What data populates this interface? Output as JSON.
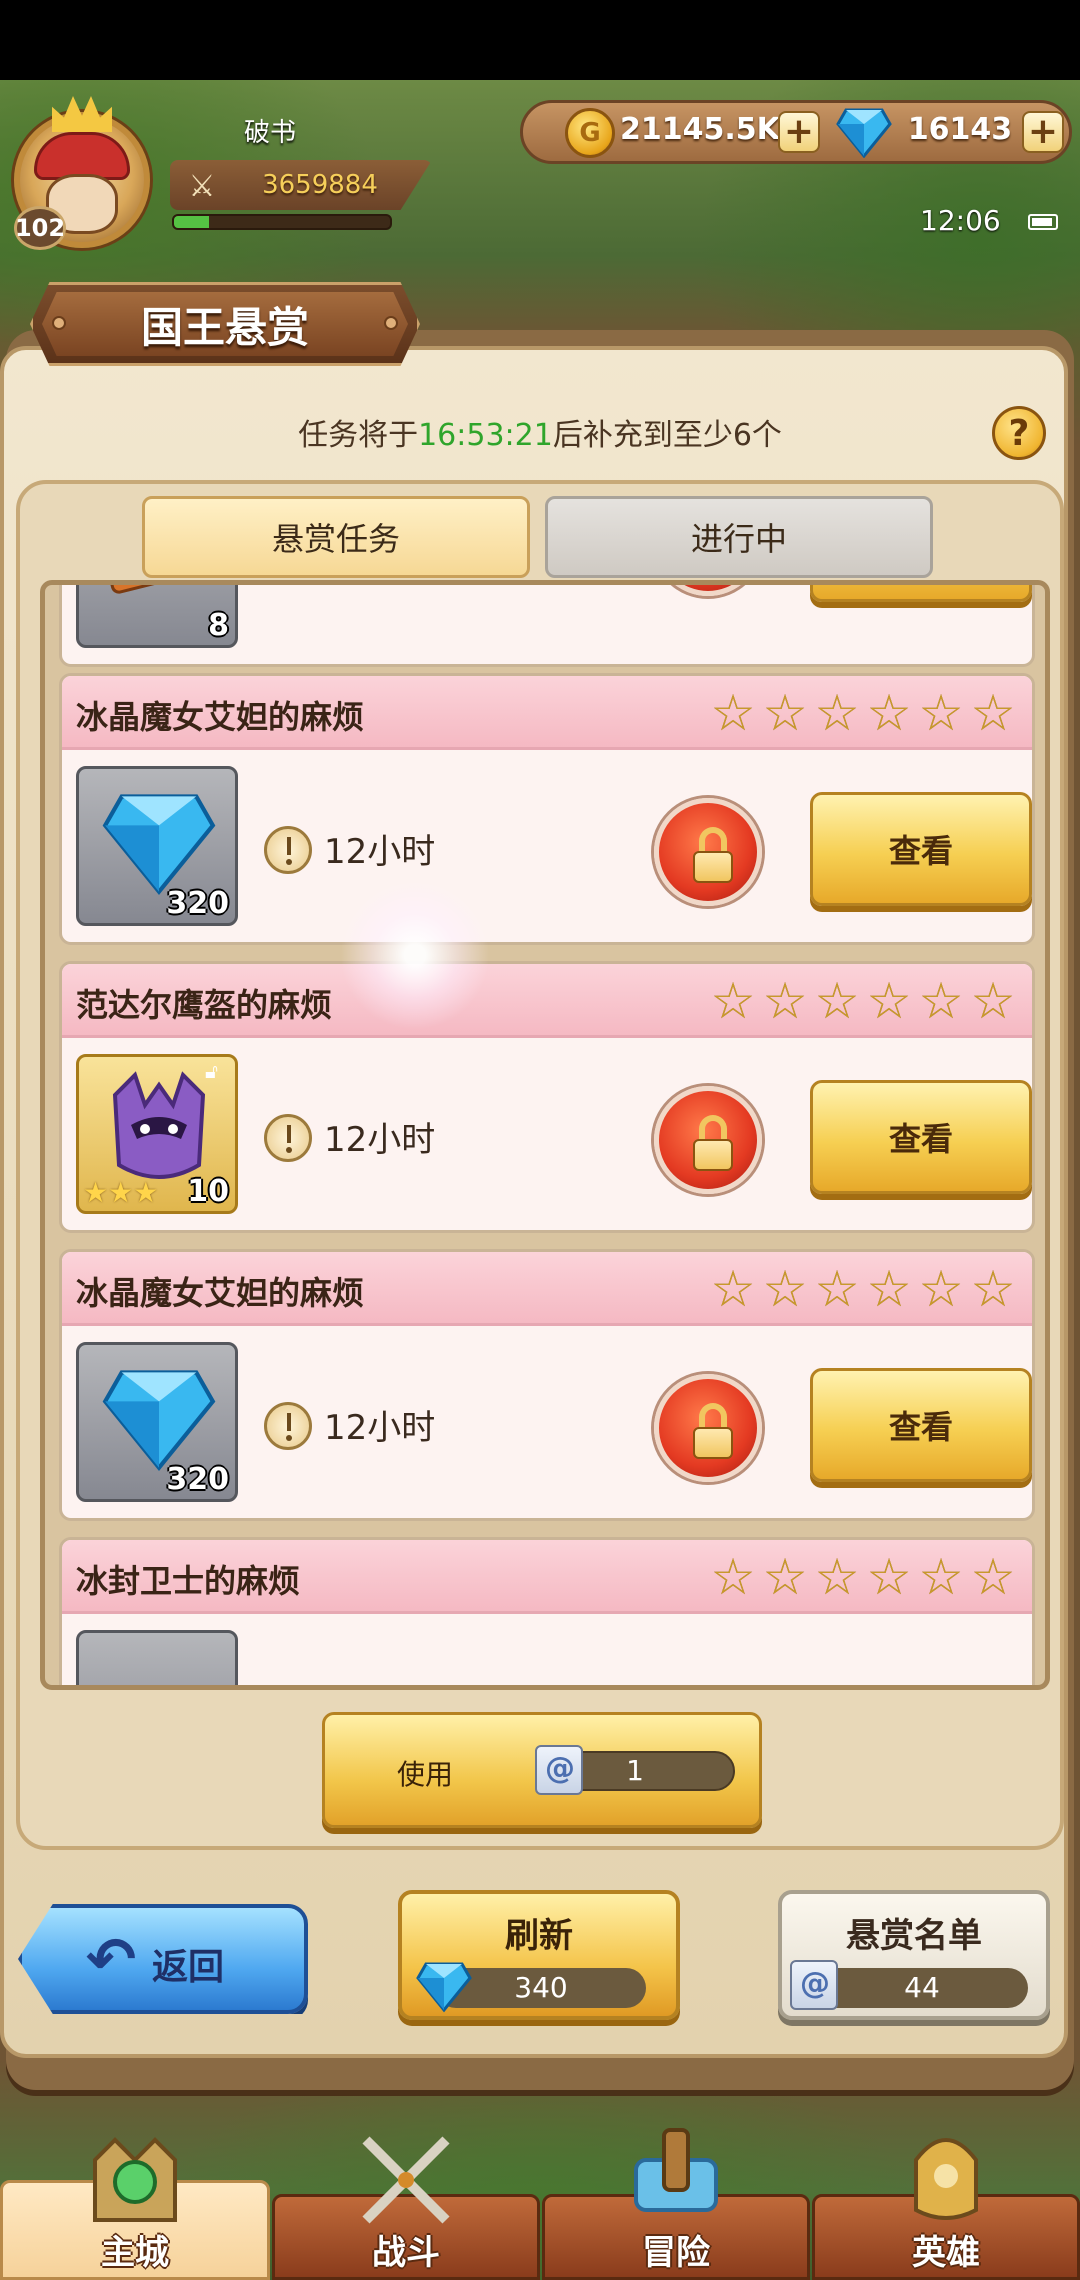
{
  "hud": {
    "player_name": "破书",
    "level": "102",
    "power": "3659884",
    "xp_fraction": 0.16,
    "gold": "21145.5K",
    "gems": "16143",
    "clock": "12:06"
  },
  "page": {
    "title": "国王悬赏",
    "refresh_prefix": "任务将于",
    "refresh_time": "16:53:21",
    "refresh_suffix": "后补充到至少6个"
  },
  "tabs": [
    {
      "label": "悬赏任务",
      "active": true
    },
    {
      "label": "进行中",
      "active": false
    }
  ],
  "partial_top_item_count": "8",
  "quests": [
    {
      "title": "冰晶魔女艾妲的麻烦",
      "stars": 6,
      "item": "gem",
      "count": "320",
      "duration": "12小时",
      "locked": true,
      "action": "查看"
    },
    {
      "title": "范达尔鹰盔的麻烦",
      "stars": 6,
      "item": "helmet",
      "count": "10",
      "item_stars": 3,
      "duration": "12小时",
      "locked": true,
      "action": "查看"
    },
    {
      "title": "冰晶魔女艾妲的麻烦",
      "stars": 6,
      "item": "gem",
      "count": "320",
      "duration": "12小时",
      "locked": true,
      "action": "查看"
    },
    {
      "title": "冰封卫士的麻烦",
      "stars": 6
    }
  ],
  "use_bar": {
    "label": "使用",
    "count": "1"
  },
  "buttons": {
    "back": "返回",
    "refresh": "刷新",
    "refresh_cost": "340",
    "roster": "悬赏名单",
    "roster_count": "44"
  },
  "nav": [
    {
      "label": "主城",
      "active": true
    },
    {
      "label": "战斗",
      "active": false
    },
    {
      "label": "冒险",
      "active": false
    },
    {
      "label": "英雄",
      "active": false
    }
  ],
  "colors": {
    "timer_green": "#2fa52b",
    "star_gold": "#c99a2a",
    "quest_header_pink": "#f5b9c3"
  }
}
